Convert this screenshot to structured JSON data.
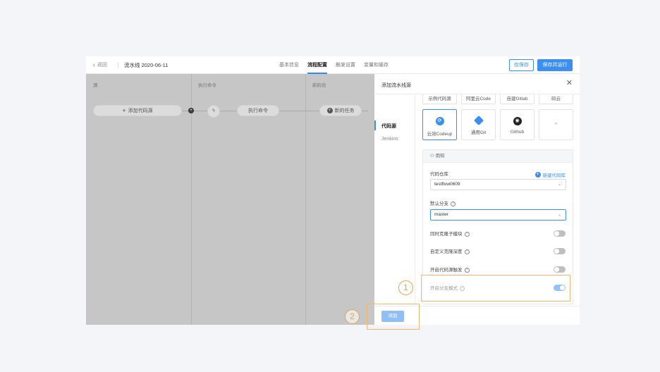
{
  "topbar": {
    "back_label": "返回",
    "pipeline_name": "流水线 2020-06-11",
    "tabs": [
      {
        "label": "基本信息",
        "active": false
      },
      {
        "label": "流程配置",
        "active": true
      },
      {
        "label": "触发设置",
        "active": false
      },
      {
        "label": "变量和缓存",
        "active": false
      }
    ],
    "save_only_label": "仅保存",
    "save_run_label": "保存并运行"
  },
  "canvas": {
    "columns": [
      "源",
      "执行命令",
      "新阶段"
    ],
    "add_source_label": "添加代码源",
    "command_label": "执行命令",
    "new_task_label": "新的任务"
  },
  "panel": {
    "title": "添加流水线源",
    "side_items": [
      {
        "label": "代码源",
        "active": true
      },
      {
        "label": "Jenkins",
        "active": false
      }
    ],
    "source_row1": [
      "示例代码源",
      "阿里云Code",
      "自建Gitlab",
      "码云"
    ],
    "source_row2": [
      {
        "label": "云效Codeup",
        "icon": "codeup-icon",
        "color": "#3b8ff3",
        "selected": true
      },
      {
        "label": "通用Git",
        "icon": "git-icon",
        "color": "#3b8ff3",
        "selected": false
      },
      {
        "label": "Github",
        "icon": "github-icon",
        "color": "#222222",
        "selected": false
      },
      {
        "label": "",
        "icon": "expand-icon",
        "color": "#aaaaaa",
        "selected": false
      }
    ],
    "account": "雨知",
    "repo_label": "代码仓库",
    "new_repo_label": "新建代码库",
    "repo_value": "testflow0609",
    "branch_label": "默认分支",
    "branch_value": "master",
    "toggles": [
      {
        "label": "同时克隆子模块",
        "on": false
      },
      {
        "label": "自定义克隆深度",
        "on": false
      },
      {
        "label": "开启代码源触发",
        "on": false
      },
      {
        "label": "开启分支模式",
        "on": true
      }
    ],
    "add_button_label": "添加"
  },
  "annotations": {
    "marker1": "1",
    "marker2": "2"
  },
  "colors": {
    "accent": "#3b8ff3",
    "highlight": "#f5b770"
  }
}
